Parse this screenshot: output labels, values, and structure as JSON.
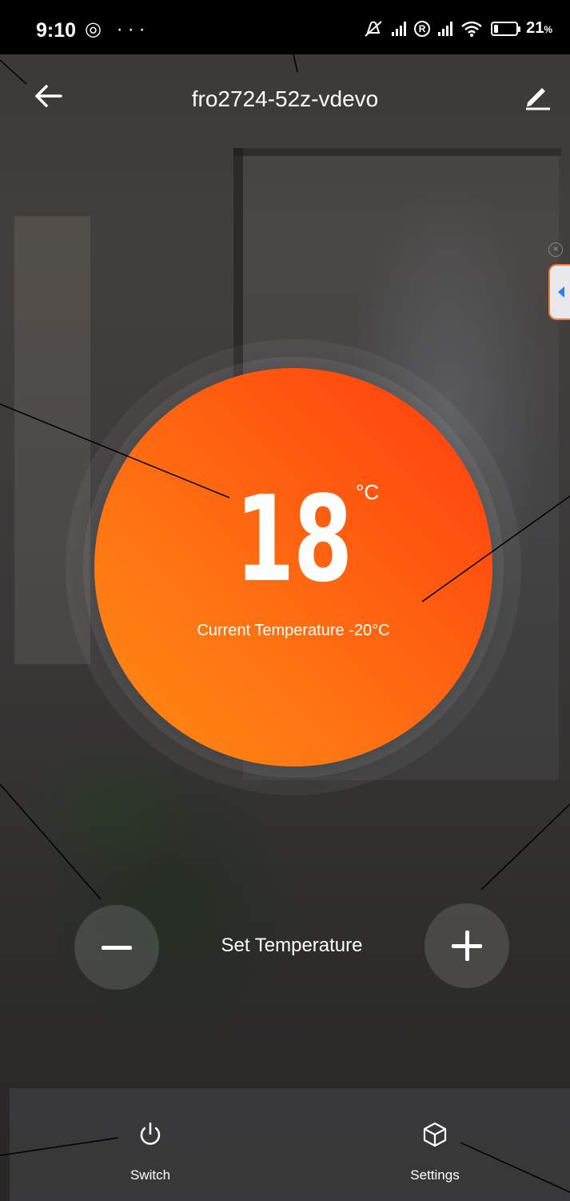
{
  "status_bar": {
    "time": "9:10",
    "left_icons": "◎ ···",
    "battery_percent": "21",
    "battery_unit": "%"
  },
  "header": {
    "title": "fro2724-52z-vdevo",
    "back_icon": "arrow-left-icon",
    "edit_icon": "pencil-icon"
  },
  "thermostat": {
    "set_temperature": "18",
    "unit": "°C",
    "current_temperature": "Current Temperature -20°C",
    "dial_color_start": "#ff3d0e",
    "dial_color_end": "#ff8a14"
  },
  "controls": {
    "set_temperature_label": "Set Temperature",
    "decrease_icon": "minus-icon",
    "increase_icon": "plus-icon"
  },
  "bottom_nav": {
    "items": [
      {
        "label": "Switch",
        "icon": "power-icon"
      },
      {
        "label": "Settings",
        "icon": "cube-icon"
      }
    ]
  }
}
